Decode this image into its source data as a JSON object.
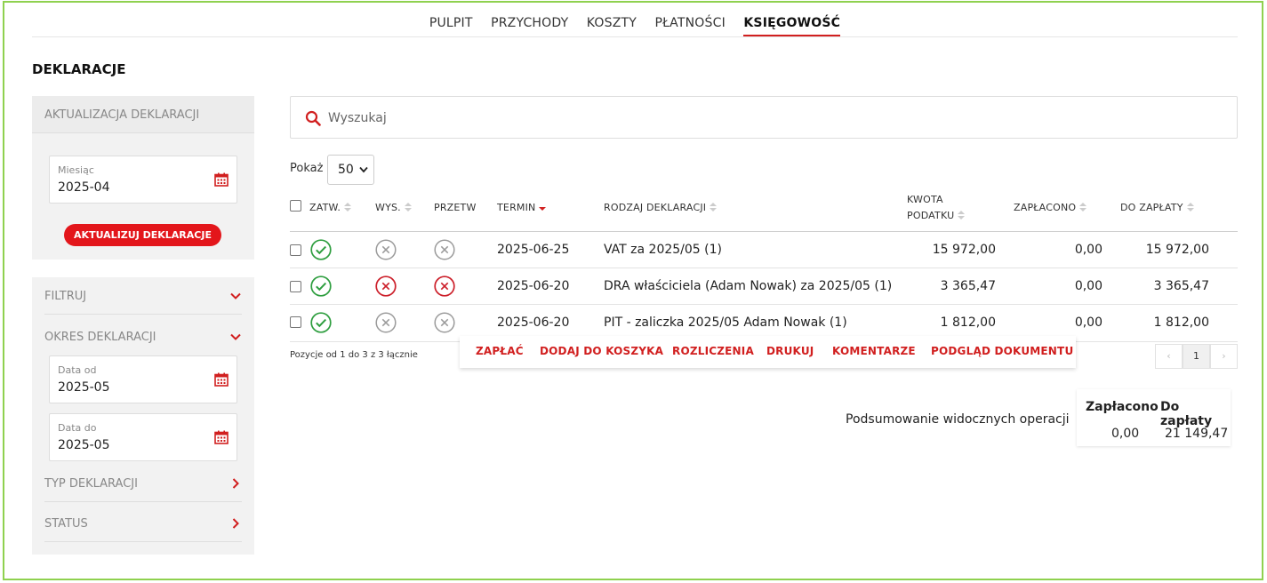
{
  "nav": {
    "items": [
      "PULPIT",
      "PRZYCHODY",
      "KOSZTY",
      "PŁATNOŚCI",
      "KSIĘGOWOŚĆ"
    ],
    "active": "KSIĘGOWOŚĆ"
  },
  "page_title": "DEKLARACJE",
  "sidebar": {
    "update_header": "AKTUALIZACJA DEKLARACJI",
    "month_label": "Miesiąc",
    "month_value": "2025-04",
    "update_button": "AKTUALIZUJ DEKLARACJE",
    "filter_label": "FILTRUJ",
    "period_label": "OKRES DEKLARACJI",
    "date_from_label": "Data od",
    "date_from_value": "2025-05",
    "date_to_label": "Data do",
    "date_to_value": "2025-05",
    "type_label": "TYP DEKLARACJI",
    "status_label": "STATUS"
  },
  "search": {
    "placeholder": "Wyszukaj"
  },
  "page_size": {
    "label": "Pokaż",
    "value": "50"
  },
  "table": {
    "headers": {
      "zatw": "ZATW.",
      "wys": "WYS.",
      "przetw": "PRZETW",
      "termin": "TERMIN",
      "rodzaj": "RODZAJ DEKLARACJI",
      "kwota_1": "KWOTA",
      "kwota_2": "PODATKU",
      "zaplacono": "ZAPŁACONO",
      "do_zaplaty": "DO ZAPŁATY"
    },
    "rows": [
      {
        "zatw": "ok",
        "wys": "neutral",
        "przetw": "neutral",
        "termin": "2025-06-25",
        "rodzaj": "VAT za 2025/05 (1)",
        "kwota": "15 972,00",
        "zaplacono": "0,00",
        "do_zaplaty": "15 972,00"
      },
      {
        "zatw": "ok",
        "wys": "error",
        "przetw": "error",
        "termin": "2025-06-20",
        "rodzaj": "DRA właściciela (Adam Nowak) za 2025/05 (1)",
        "kwota": "3 365,47",
        "zaplacono": "0,00",
        "do_zaplaty": "3 365,47"
      },
      {
        "zatw": "ok",
        "wys": "neutral",
        "przetw": "neutral",
        "termin": "2025-06-20",
        "rodzaj": "PIT - zaliczka 2025/05 Adam Nowak (1)",
        "kwota": "1 812,00",
        "zaplacono": "0,00",
        "do_zaplaty": "1 812,00"
      }
    ],
    "info": "Pozycje od 1 do 3 z 3 łącznie"
  },
  "actions": [
    "ZAPŁAĆ",
    "DODAJ DO KOSZYKA",
    "ROZLICZENIA",
    "DRUKUJ",
    "KOMENTARZE",
    "PODGLĄD DOKUMENTU"
  ],
  "pagination": {
    "prev": "‹",
    "current": "1",
    "next": "›"
  },
  "summary": {
    "label": "Podsumowanie widocznych operacji",
    "paid_header": "Zapłacono",
    "due_header": "Do zapłaty",
    "paid_value": "0,00",
    "due_value": "21 149,47"
  },
  "colors": {
    "accent": "#d11f1f",
    "ok": "#2e9e3f",
    "error": "#cc1f2a",
    "neutral": "#9a9a9a",
    "frame": "#8fd14f"
  },
  "icons": {
    "status_ok": "check-circle-icon",
    "status_error": "x-circle-icon",
    "status_neutral": "x-circle-icon",
    "date": "calendar-icon",
    "search": "search-icon"
  }
}
